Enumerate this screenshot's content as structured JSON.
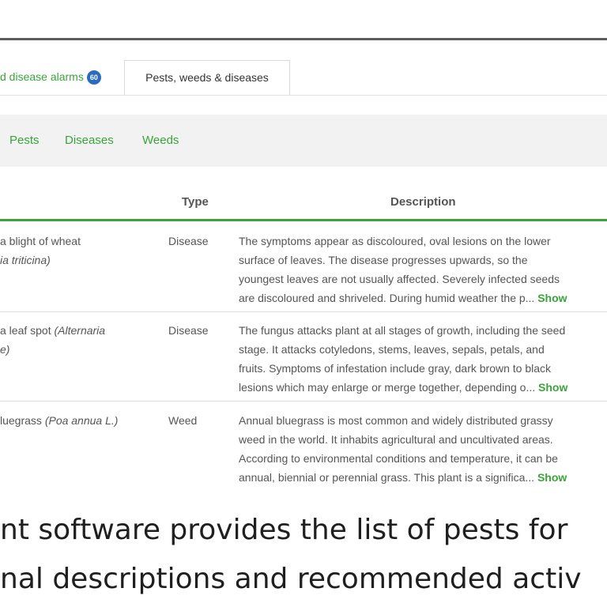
{
  "tabs": {
    "alarms_label": "d disease alarms",
    "alarms_badge": "60",
    "active_label": "Pests, weeds & diseases"
  },
  "filters": [
    "Pests",
    "Diseases",
    "Weeds"
  ],
  "table": {
    "columns": {
      "type": "Type",
      "description": "Description"
    },
    "rows": [
      {
        "name_lines": [
          {
            "text": "a blight of wheat",
            "sci": ""
          },
          {
            "text": "",
            "sci": "ia triticina)"
          }
        ],
        "type": "Disease",
        "desc_lines": [
          "The symptoms appear as discoloured, oval lesions on the lower",
          "surface of leaves. The disease progresses upwards, so the",
          "youngest leaves are not usually affected. Severely infected seeds",
          "are discoloured and shriveled. During humid weather the p..."
        ],
        "show_more": "Show"
      },
      {
        "name_lines": [
          {
            "text": "a leaf spot ",
            "sci": "(Alternaria"
          },
          {
            "text": "",
            "sci": "e)"
          }
        ],
        "type": "Disease",
        "desc_lines": [
          "The fungus attacks plant at all stages of growth, including the seed",
          "stage. It attacks cotyledons, stems, leaves, sepals, petals, and",
          "fruits. Symptoms of infestation include gray, dark brown to black",
          "lesions which may enlarge or merge together, depending o..."
        ],
        "show_more": "Show"
      },
      {
        "name_lines": [
          {
            "text": "luegrass ",
            "sci": "(Poa annua L.)"
          }
        ],
        "type": "Weed",
        "desc_lines": [
          "Annual bluegrass is most common and widely distributed grassy",
          "weed in the world. It inhabits agricultural and uncultivated areas.",
          "According to environmental conditions and temperature, it can be",
          "annual, biennial or perennial grass. This plant is a significa..."
        ],
        "show_more": "Show"
      }
    ]
  },
  "caption": {
    "line1": "nt software provides the list of pests for",
    "line2": "nal descriptions and recommended activ"
  },
  "colors": {
    "accent": "#3aa43a",
    "badge": "#2a6bbf",
    "text": "#555555"
  }
}
